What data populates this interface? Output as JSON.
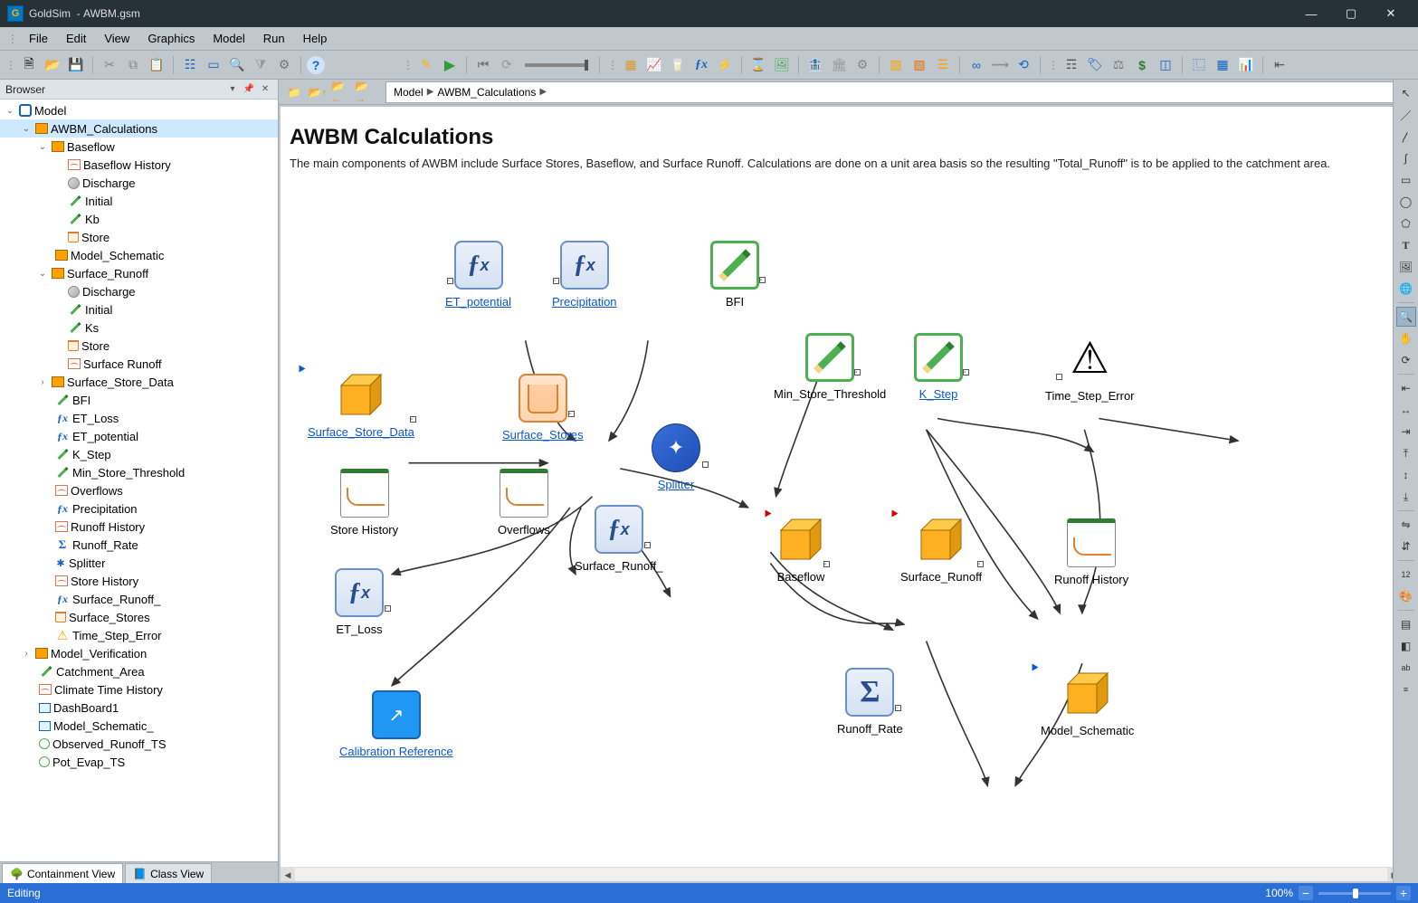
{
  "window": {
    "app": "GoldSim",
    "doc": "AWBM.gsm"
  },
  "menu": [
    "File",
    "Edit",
    "View",
    "Graphics",
    "Model",
    "Run",
    "Help"
  ],
  "breadcrumb": [
    "Model",
    "AWBM_Calculations"
  ],
  "browser": {
    "title": "Browser",
    "tabs": {
      "containment": "Containment View",
      "class": "Class View"
    },
    "tree": {
      "root": "Model",
      "awbm": "AWBM_Calculations",
      "baseflow": "Baseflow",
      "baseflow_children": [
        "Baseflow History",
        "Discharge",
        "Initial",
        "Kb",
        "Store"
      ],
      "model_schematic": "Model_Schematic",
      "surface_runoff": "Surface_Runoff",
      "surface_runoff_children": [
        "Discharge",
        "Initial",
        "Ks",
        "Store",
        "Surface Runoff"
      ],
      "surface_store_data": "Surface_Store_Data",
      "others": [
        "BFI",
        "ET_Loss",
        "ET_potential",
        "K_Step",
        "Min_Store_Threshold",
        "Overflows",
        "Precipitation",
        "Runoff History",
        "Runoff_Rate",
        "Splitter",
        "Store History",
        "Surface_Runoff_",
        "Surface_Stores",
        "Time_Step_Error"
      ],
      "model_verification": "Model_Verification",
      "tail": [
        "Catchment_Area",
        "Climate Time History",
        "DashBoard1",
        "Model_Schematic_",
        "Observed_Runoff_TS",
        "Pot_Evap_TS"
      ]
    }
  },
  "canvas": {
    "title": "AWBM Calculations",
    "desc": "The main components of AWBM include Surface Stores, Baseflow, and Surface Runoff. Calculations are done on a unit area basis so the resulting \"Total_Runoff\" is to be applied to the catchment area.",
    "nodes": {
      "et_potential": "ET_potential",
      "precipitation": "Precipitation",
      "bfi": "BFI",
      "min_store_threshold": "Min_Store_Threshold",
      "k_step": "K_Step",
      "time_step_error": "Time_Step_Error",
      "surface_store_data": "Surface_Store_Data",
      "surface_stores": "Surface_Stores",
      "splitter": "Splitter",
      "store_history": "Store History",
      "overflows": "Overflows",
      "surface_runoff_": "Surface_Runoff_",
      "baseflow": "Baseflow",
      "surface_runoff": "Surface_Runoff",
      "runoff_history": "Runoff History",
      "et_loss": "ET_Loss",
      "runoff_rate": "Runoff_Rate",
      "model_schematic": "Model_Schematic",
      "calibration_reference": "Calibration Reference"
    }
  },
  "status": {
    "mode": "Editing",
    "zoom": "100%"
  }
}
